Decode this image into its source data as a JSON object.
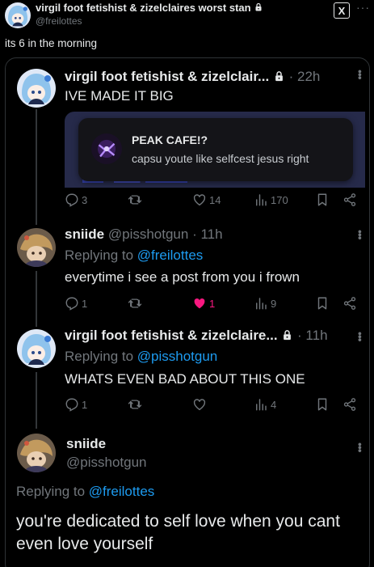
{
  "header": {
    "display_name": "virgil foot fetishist & zizelclaires worst stan",
    "handle": "@freilottes",
    "x_logo": "X",
    "more": "···"
  },
  "caption": "its 6 in the morning",
  "posts": [
    {
      "name": "virgil foot fetishist & zizelclair...",
      "time": "· 22h",
      "text": "IVE MADE IT BIG",
      "embed": {
        "title": "PEAK CAFE!?",
        "body": "capsu youte like selfcest jesus right"
      },
      "stats": {
        "replies": "3",
        "likes": "14",
        "views": "170"
      }
    },
    {
      "name": "sniide",
      "handle_time": "@pisshotgun · 11h",
      "replying_prefix": "Replying to ",
      "replying_to": "@freilottes",
      "text": "everytime i see a post from you i frown",
      "stats": {
        "replies": "1",
        "likes": "1",
        "views": "9"
      }
    },
    {
      "name": "virgil foot fetishist & zizelclaire...",
      "time": "· 11h",
      "replying_prefix": "Replying to ",
      "replying_to": "@pisshotgun",
      "text": "WHATS EVEN BAD ABOUT THIS ONE",
      "stats": {
        "replies": "1",
        "likes": "",
        "views": "4"
      }
    }
  ],
  "main": {
    "name": "sniide",
    "handle": "@pisshotgun",
    "replying_prefix": "Replying to ",
    "replying_to": "@freilottes",
    "line1": "you're dedicated to self love when you cant",
    "line2": "even love yourself"
  },
  "colors": {
    "accent": "#1d9bf0",
    "like": "#f91880",
    "muted": "#71767b",
    "text": "#e7e9ea"
  }
}
